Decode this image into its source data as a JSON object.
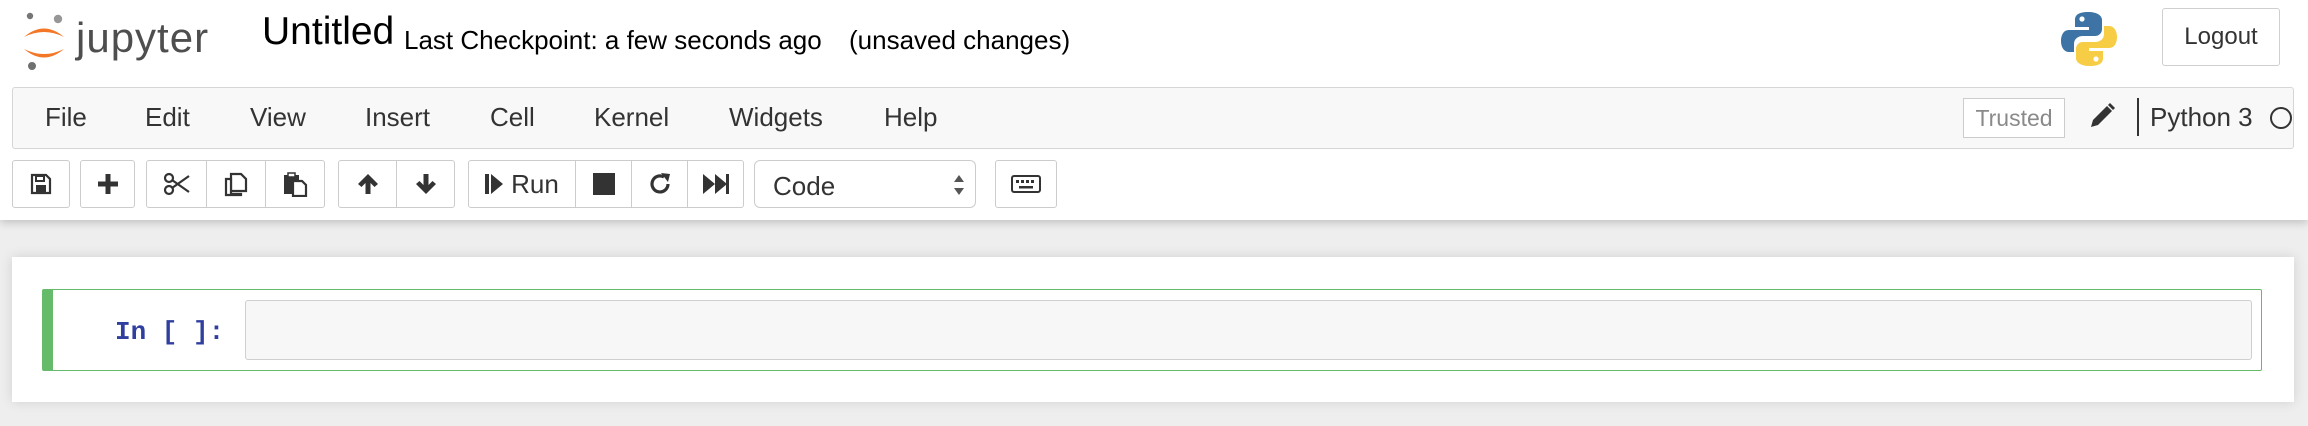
{
  "header": {
    "logo_text": "jupyter",
    "notebook_name": "Untitled",
    "checkpoint": "Last Checkpoint: a few seconds ago",
    "autosave_status": "(unsaved changes)",
    "logout_label": "Logout"
  },
  "menubar": {
    "items": [
      "File",
      "Edit",
      "View",
      "Insert",
      "Cell",
      "Kernel",
      "Widgets",
      "Help"
    ],
    "trusted_label": "Trusted",
    "kernel_name": "Python 3"
  },
  "toolbar": {
    "icons": [
      "save-icon",
      "plus-icon",
      "cut-icon",
      "copy-icon",
      "paste-icon",
      "arrow-up-icon",
      "arrow-down-icon",
      "step-forward-icon",
      "stop-icon",
      "restart-icon",
      "fast-forward-icon",
      "keyboard-icon"
    ],
    "run_label": "Run",
    "cell_type": "Code"
  },
  "cell": {
    "prompt": "In [ ]:",
    "source": ""
  },
  "colors": {
    "accent_orange": "#f37726",
    "selected_cell_border": "#66bb6a",
    "prompt_blue": "#303f9f"
  }
}
